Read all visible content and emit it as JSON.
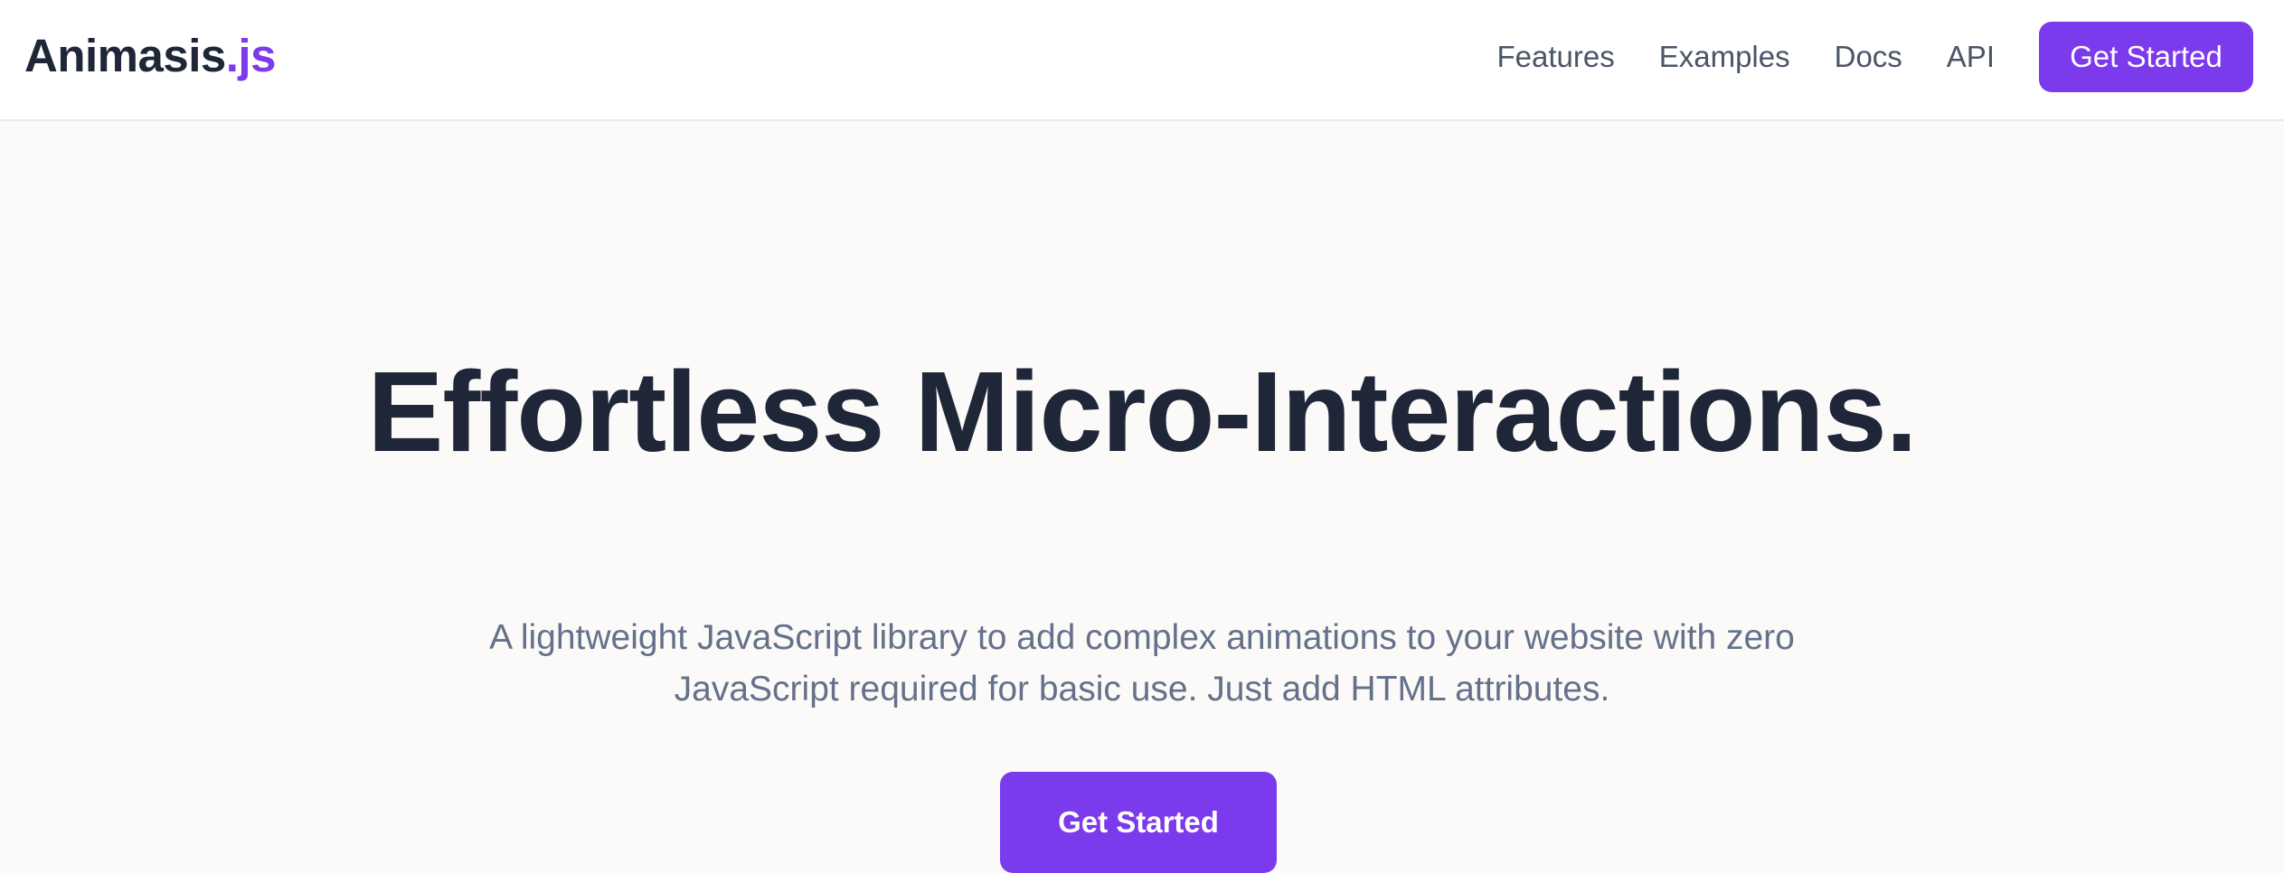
{
  "header": {
    "logo": {
      "name": "Animasis",
      "suffix": ".js"
    },
    "nav": {
      "links": [
        "Features",
        "Examples",
        "Docs",
        "API"
      ],
      "cta_label": "Get Started"
    }
  },
  "hero": {
    "title": "Effortless Micro-Interactions.",
    "subtitle": "A lightweight JavaScript library to add complex animations to your website with zero JavaScript required for basic use. Just add HTML attributes.",
    "cta_label": "Get Started"
  },
  "colors": {
    "accent": "#7c3aed",
    "heading": "#1e2638",
    "body_text": "#65718a",
    "nav_text": "#4a5568",
    "header_bg": "#ffffff",
    "page_bg": "#fbfaf8"
  }
}
